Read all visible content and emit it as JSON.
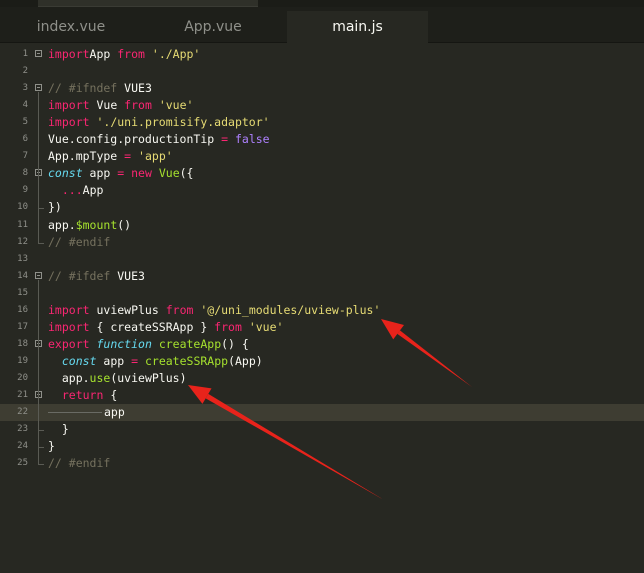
{
  "tabs": [
    {
      "label": "index.vue"
    },
    {
      "label": "App.vue"
    },
    {
      "label": "main.js"
    }
  ],
  "lines": [
    {
      "n": "1",
      "parts": [
        [
          "kw",
          "import"
        ],
        [
          "",
          "App "
        ],
        [
          "kw",
          "from"
        ],
        [
          "",
          " "
        ],
        [
          "str",
          "'./App'"
        ]
      ]
    },
    {
      "n": "2",
      "parts": []
    },
    {
      "n": "3",
      "parts": [
        [
          "cm",
          "// #ifndef "
        ],
        [
          "macro",
          "VUE3"
        ]
      ]
    },
    {
      "n": "4",
      "parts": [
        [
          "kw",
          "import"
        ],
        [
          "",
          " Vue "
        ],
        [
          "kw",
          "from"
        ],
        [
          "",
          " "
        ],
        [
          "str",
          "'vue'"
        ]
      ]
    },
    {
      "n": "5",
      "parts": [
        [
          "kw",
          "import"
        ],
        [
          "",
          " "
        ],
        [
          "str",
          "'./uni.promisify.adaptor'"
        ]
      ]
    },
    {
      "n": "6",
      "parts": [
        [
          "",
          "Vue.config.productionTip "
        ],
        [
          "kw",
          "="
        ],
        [
          "",
          " "
        ],
        [
          "bool",
          "false"
        ]
      ]
    },
    {
      "n": "7",
      "parts": [
        [
          "",
          "App.mpType "
        ],
        [
          "kw",
          "="
        ],
        [
          "",
          " "
        ],
        [
          "str",
          "'app'"
        ]
      ]
    },
    {
      "n": "8",
      "parts": [
        [
          "it",
          "const"
        ],
        [
          "",
          " app "
        ],
        [
          "kw",
          "="
        ],
        [
          "",
          " "
        ],
        [
          "kw",
          "new"
        ],
        [
          "",
          " "
        ],
        [
          "fn",
          "Vue"
        ],
        [
          "",
          "({"
        ]
      ]
    },
    {
      "n": "9",
      "parts": [
        [
          "",
          "  "
        ],
        [
          "kw",
          "..."
        ],
        [
          "",
          "App"
        ]
      ]
    },
    {
      "n": "10",
      "parts": [
        [
          "",
          "})"
        ]
      ]
    },
    {
      "n": "11",
      "parts": [
        [
          "",
          "app."
        ],
        [
          "fn",
          "$mount"
        ],
        [
          "",
          "()"
        ]
      ]
    },
    {
      "n": "12",
      "parts": [
        [
          "cm",
          "// #endif"
        ]
      ]
    },
    {
      "n": "13",
      "parts": []
    },
    {
      "n": "14",
      "parts": [
        [
          "cm",
          "// #ifdef "
        ],
        [
          "macro",
          "VUE3"
        ]
      ]
    },
    {
      "n": "15",
      "parts": []
    },
    {
      "n": "16",
      "parts": [
        [
          "kw",
          "import"
        ],
        [
          "",
          " uviewPlus "
        ],
        [
          "kw",
          "from"
        ],
        [
          "",
          " "
        ],
        [
          "str",
          "'@/uni_modules/uview-plus'"
        ]
      ]
    },
    {
      "n": "17",
      "parts": [
        [
          "kw",
          "import"
        ],
        [
          "",
          " { createSSRApp } "
        ],
        [
          "kw",
          "from"
        ],
        [
          "",
          " "
        ],
        [
          "str",
          "'vue'"
        ]
      ]
    },
    {
      "n": "18",
      "parts": [
        [
          "kw",
          "export"
        ],
        [
          "",
          " "
        ],
        [
          "it",
          "function"
        ],
        [
          "",
          " "
        ],
        [
          "fn",
          "createApp"
        ],
        [
          "",
          "() {"
        ]
      ]
    },
    {
      "n": "19",
      "parts": [
        [
          "",
          "  "
        ],
        [
          "it",
          "const"
        ],
        [
          "",
          " app "
        ],
        [
          "kw",
          "="
        ],
        [
          "",
          " "
        ],
        [
          "fn",
          "createSSRApp"
        ],
        [
          "",
          "(App)"
        ]
      ]
    },
    {
      "n": "20",
      "parts": [
        [
          "",
          "  app."
        ],
        [
          "fn",
          "use"
        ],
        [
          "",
          "(uviewPlus)"
        ]
      ]
    },
    {
      "n": "21",
      "parts": [
        [
          "",
          "  "
        ],
        [
          "kw",
          "return"
        ],
        [
          "",
          " {"
        ]
      ]
    },
    {
      "n": "22",
      "parts": [
        [
          "guide",
          ""
        ],
        [
          "",
          "app"
        ]
      ]
    },
    {
      "n": "23",
      "parts": [
        [
          "",
          "  }"
        ]
      ]
    },
    {
      "n": "24",
      "parts": [
        [
          "",
          "}"
        ]
      ]
    },
    {
      "n": "25",
      "parts": [
        [
          "cm",
          "// #endif"
        ]
      ]
    }
  ],
  "colors": {
    "background": "#272822",
    "keyword": "#f92672",
    "string": "#e6db74",
    "comment": "#75715e",
    "function": "#a6e22e",
    "storage": "#66d9ef",
    "constant": "#ae81ff",
    "annotation_arrow": "#e8231b"
  }
}
